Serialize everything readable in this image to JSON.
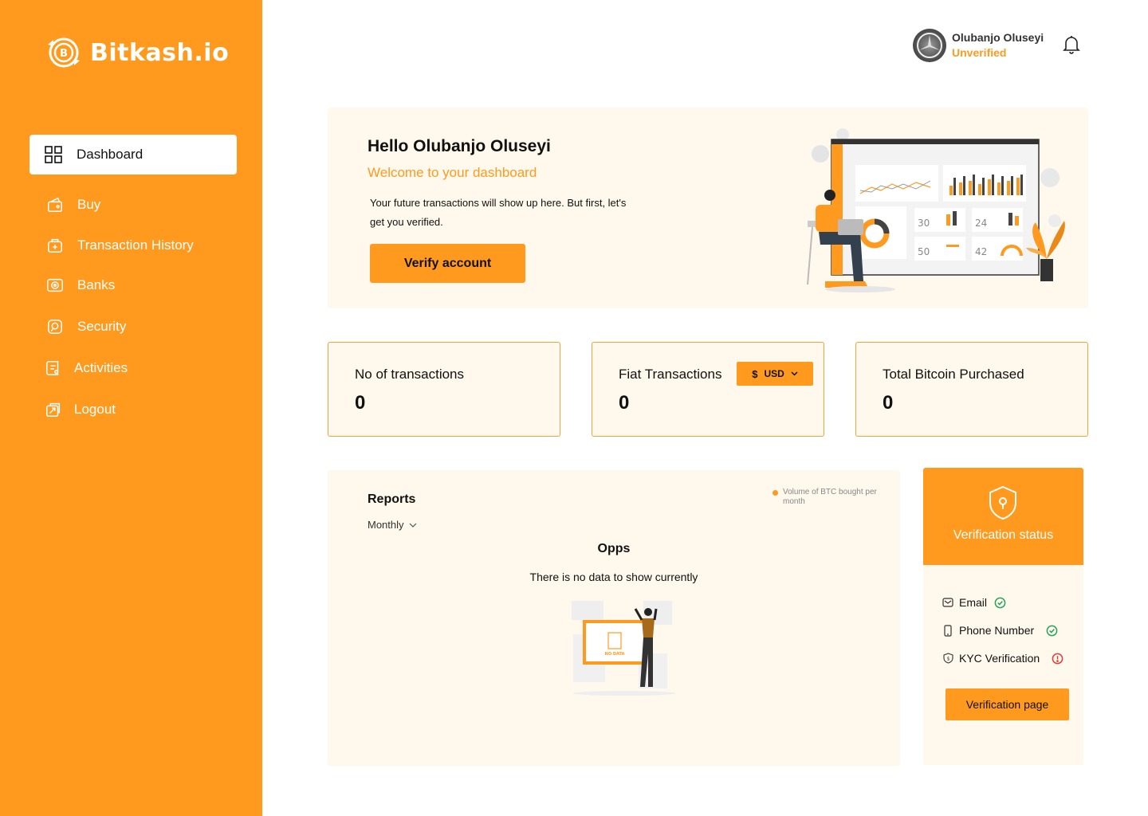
{
  "brand": {
    "name": "Bitkash.io",
    "accent": "#FF9A1F",
    "card_bg": "#FFF8EC"
  },
  "sidebar": {
    "items": [
      {
        "label": "Dashboard",
        "icon": "grid-icon",
        "active": true
      },
      {
        "label": "Buy",
        "icon": "wallet-icon"
      },
      {
        "label": "Transaction History",
        "icon": "history-icon"
      },
      {
        "label": "Banks",
        "icon": "bank-icon"
      },
      {
        "label": "Security",
        "icon": "security-icon"
      },
      {
        "label": "Activities",
        "icon": "activities-icon"
      },
      {
        "label": "Logout",
        "icon": "logout-icon"
      }
    ]
  },
  "header": {
    "user_name": "Olubanjo Oluseyi",
    "user_status": "Unverified",
    "notification_icon": "bell-icon"
  },
  "welcome": {
    "greeting": "Hello Olubanjo Oluseyi",
    "subtitle": "Welcome to your dashboard",
    "description": "Your future transactions will show up here. But first, let's get you verified.",
    "button_label": "Verify account"
  },
  "stats": [
    {
      "label": "No of transactions",
      "value": "0"
    },
    {
      "label": "Fiat Transactions",
      "value": "0",
      "currency_symbol": "$",
      "currency": "USD"
    },
    {
      "label": "Total Bitcoin Purchased",
      "value": "0"
    }
  ],
  "reports": {
    "title": "Reports",
    "period": "Monthly",
    "legend": "Volume of BTC bought per month",
    "empty_title": "Opps",
    "empty_message": "There is no data to show currently",
    "illustration_text": "NO DATA"
  },
  "verification": {
    "title": "Verification status",
    "items": [
      {
        "label": "Email",
        "icon": "mail-icon",
        "status": "verified",
        "status_color": "#22A35A"
      },
      {
        "label": "Phone Number",
        "icon": "phone-icon",
        "status": "verified",
        "status_color": "#22A35A"
      },
      {
        "label": "KYC Verification",
        "icon": "kyc-icon",
        "status": "pending",
        "status_color": "#E53935"
      }
    ],
    "button_label": "Verification page"
  },
  "illustration": {
    "numbers": [
      "30",
      "24",
      "50",
      "42"
    ]
  }
}
